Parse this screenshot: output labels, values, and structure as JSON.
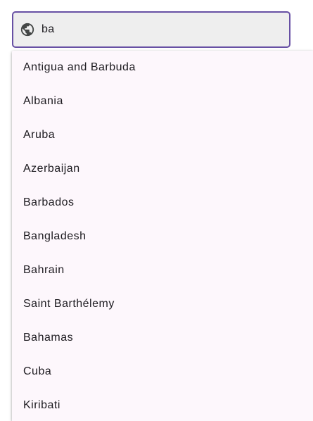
{
  "search": {
    "value": "ba",
    "icon": "globe-icon"
  },
  "suggestions": [
    {
      "label": "Antigua and Barbuda"
    },
    {
      "label": "Albania"
    },
    {
      "label": "Aruba"
    },
    {
      "label": "Azerbaijan"
    },
    {
      "label": "Barbados"
    },
    {
      "label": "Bangladesh"
    },
    {
      "label": "Bahrain"
    },
    {
      "label": "Saint Barthélemy"
    },
    {
      "label": "Bahamas"
    },
    {
      "label": "Cuba"
    },
    {
      "label": "Kiribati"
    }
  ],
  "colors": {
    "accent": "#6750a4",
    "field_background": "#eeeeee",
    "menu_background": "#fdf7fc",
    "text": "#1d1b20"
  }
}
